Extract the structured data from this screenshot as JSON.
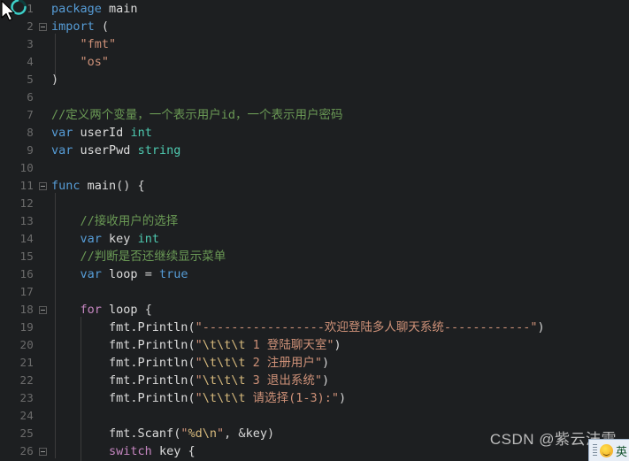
{
  "editor": {
    "language": "go",
    "theme_background": "#1d1f21",
    "gutter_color": "#6b6b6b",
    "colors": {
      "keyword": "#569cd6",
      "control": "#c586c0",
      "type": "#4ec9b0",
      "string": "#ce9178",
      "comment": "#6a9955",
      "escape": "#d7ba7d",
      "text": "#d4d4d4"
    },
    "lines": [
      {
        "n": "1",
        "fold": false,
        "text": "package main"
      },
      {
        "n": "2",
        "fold": true,
        "text": "import ("
      },
      {
        "n": "3",
        "fold": false,
        "text": "    \"fmt\""
      },
      {
        "n": "4",
        "fold": false,
        "text": "    \"os\""
      },
      {
        "n": "5",
        "fold": false,
        "text": ")"
      },
      {
        "n": "6",
        "fold": false,
        "text": ""
      },
      {
        "n": "7",
        "fold": false,
        "text": "//定义两个变量，一个表示用户id，一个表示用户密码"
      },
      {
        "n": "8",
        "fold": false,
        "text": "var userId int"
      },
      {
        "n": "9",
        "fold": false,
        "text": "var userPwd string"
      },
      {
        "n": "10",
        "fold": false,
        "text": ""
      },
      {
        "n": "11",
        "fold": true,
        "text": "func main() {"
      },
      {
        "n": "12",
        "fold": false,
        "text": ""
      },
      {
        "n": "13",
        "fold": false,
        "text": "    //接收用户的选择"
      },
      {
        "n": "14",
        "fold": false,
        "text": "    var key int"
      },
      {
        "n": "15",
        "fold": false,
        "text": "    //判断是否还继续显示菜单"
      },
      {
        "n": "16",
        "fold": false,
        "text": "    var loop = true"
      },
      {
        "n": "17",
        "fold": false,
        "text": ""
      },
      {
        "n": "18",
        "fold": true,
        "text": "    for loop {"
      },
      {
        "n": "19",
        "fold": false,
        "text": "        fmt.Println(\"-----------------欢迎登陆多人聊天系统------------\")"
      },
      {
        "n": "20",
        "fold": false,
        "text": "        fmt.Println(\"\\t\\t\\t 1 登陆聊天室\")"
      },
      {
        "n": "21",
        "fold": false,
        "text": "        fmt.Println(\"\\t\\t\\t 2 注册用户\")"
      },
      {
        "n": "22",
        "fold": false,
        "text": "        fmt.Println(\"\\t\\t\\t 3 退出系统\")"
      },
      {
        "n": "23",
        "fold": false,
        "text": "        fmt.Println(\"\\t\\t\\t 请选择(1-3):\")"
      },
      {
        "n": "24",
        "fold": false,
        "text": ""
      },
      {
        "n": "25",
        "fold": false,
        "text": "        fmt.Scanf(\"%d\\n\", &key)"
      },
      {
        "n": "26",
        "fold": true,
        "text": "        switch key {"
      }
    ]
  },
  "watermark": {
    "text": "CSDN @紫云沫雪"
  },
  "ime": {
    "language_label": "英",
    "icon": "sogou-bulb-icon"
  },
  "cursor": {
    "icon": "arrow-busy-cursor",
    "spinner_color": "#3fd0c9"
  }
}
